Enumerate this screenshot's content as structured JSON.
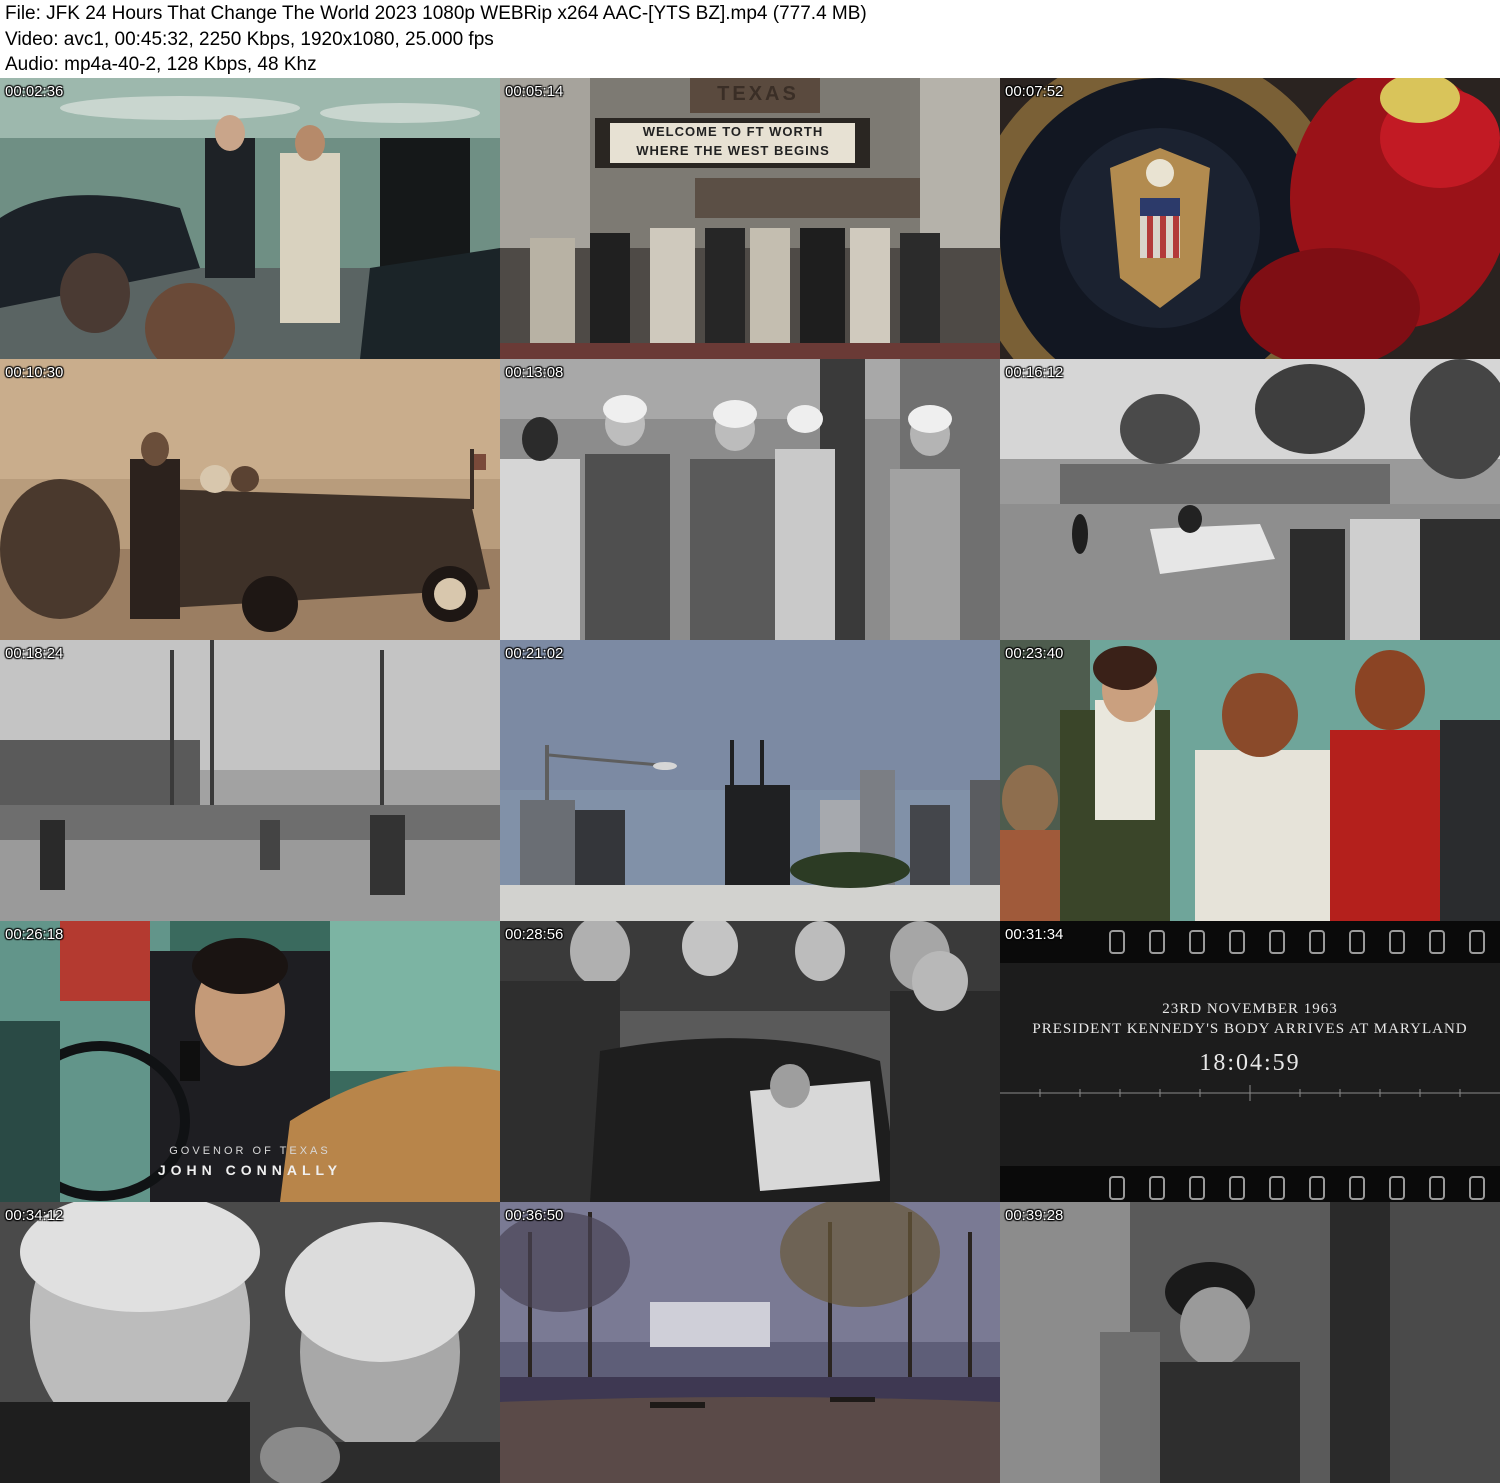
{
  "info": {
    "file_line": "File: JFK 24 Hours That Change The World 2023 1080p WEBRip x264 AAC-[YTS BZ].mp4 (777.4 MB)",
    "video_line": "Video: avc1, 00:45:32, 2250 Kbps, 1920x1080, 25.000 fps",
    "audio_line": "Audio: mp4a-40-2, 128 Kbps, 48 Khz"
  },
  "thumbnails": [
    {
      "timestamp": "00:02:36"
    },
    {
      "timestamp": "00:05:14",
      "sign_top": "TEXAS",
      "marquee_line1": "WELCOME TO FT WORTH",
      "marquee_line2": "WHERE THE WEST BEGINS"
    },
    {
      "timestamp": "00:07:52"
    },
    {
      "timestamp": "00:10:30"
    },
    {
      "timestamp": "00:13:08"
    },
    {
      "timestamp": "00:16:12"
    },
    {
      "timestamp": "00:18:24"
    },
    {
      "timestamp": "00:21:02"
    },
    {
      "timestamp": "00:23:40"
    },
    {
      "timestamp": "00:26:18",
      "caption_small": "GOVENOR OF TEXAS",
      "caption_large": "JOHN CONNALLY"
    },
    {
      "timestamp": "00:28:56"
    },
    {
      "timestamp": "00:31:34",
      "date_line": "23RD NOVEMBER 1963",
      "event_line": "PRESIDENT KENNEDY'S BODY ARRIVES AT MARYLAND",
      "clock": "18:04:59"
    },
    {
      "timestamp": "00:34:12"
    },
    {
      "timestamp": "00:36:50"
    },
    {
      "timestamp": "00:39:28"
    }
  ]
}
